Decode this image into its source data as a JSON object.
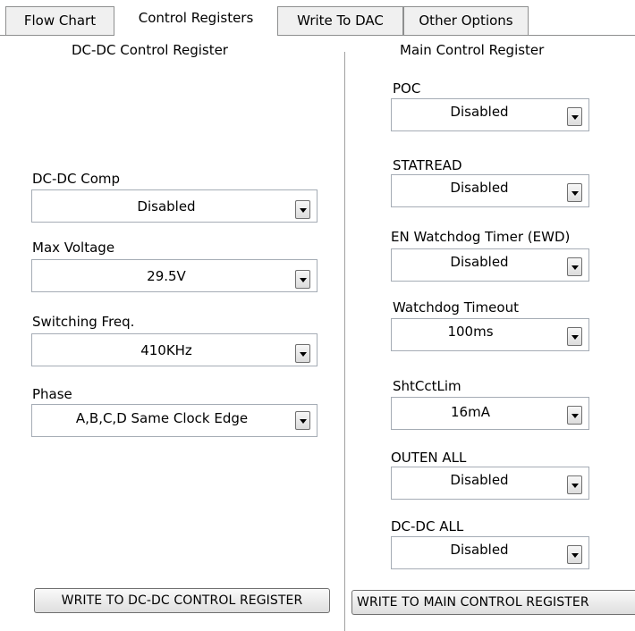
{
  "tabs": [
    {
      "label": "Flow Chart",
      "active": false
    },
    {
      "label": "Control Registers",
      "active": true
    },
    {
      "label": "Write To DAC",
      "active": false
    },
    {
      "label": "Other Options",
      "active": false
    }
  ],
  "dcdc": {
    "title": "DC-DC Control Register",
    "fields": [
      {
        "label": "DC-DC Comp",
        "value": "Disabled"
      },
      {
        "label": "Max Voltage",
        "value": "29.5V"
      },
      {
        "label": "Switching Freq.",
        "value": "410KHz"
      },
      {
        "label": "Phase",
        "value": "A,B,C,D Same Clock Edge"
      }
    ],
    "write_button": "WRITE TO DC-DC CONTROL REGISTER"
  },
  "main": {
    "title": "Main Control Register",
    "fields": [
      {
        "label": "POC",
        "value": "Disabled"
      },
      {
        "label": "STATREAD",
        "value": "Disabled"
      },
      {
        "label": "EN Watchdog Timer (EWD)",
        "value": "Disabled"
      },
      {
        "label": "Watchdog Timeout",
        "value": "100ms"
      },
      {
        "label": "ShtCctLim",
        "value": "16mA"
      },
      {
        "label": "OUTEN ALL",
        "value": "Disabled"
      },
      {
        "label": "DC-DC ALL",
        "value": "Disabled"
      }
    ],
    "write_button": "WRITE TO MAIN CONTROL REGISTER"
  }
}
